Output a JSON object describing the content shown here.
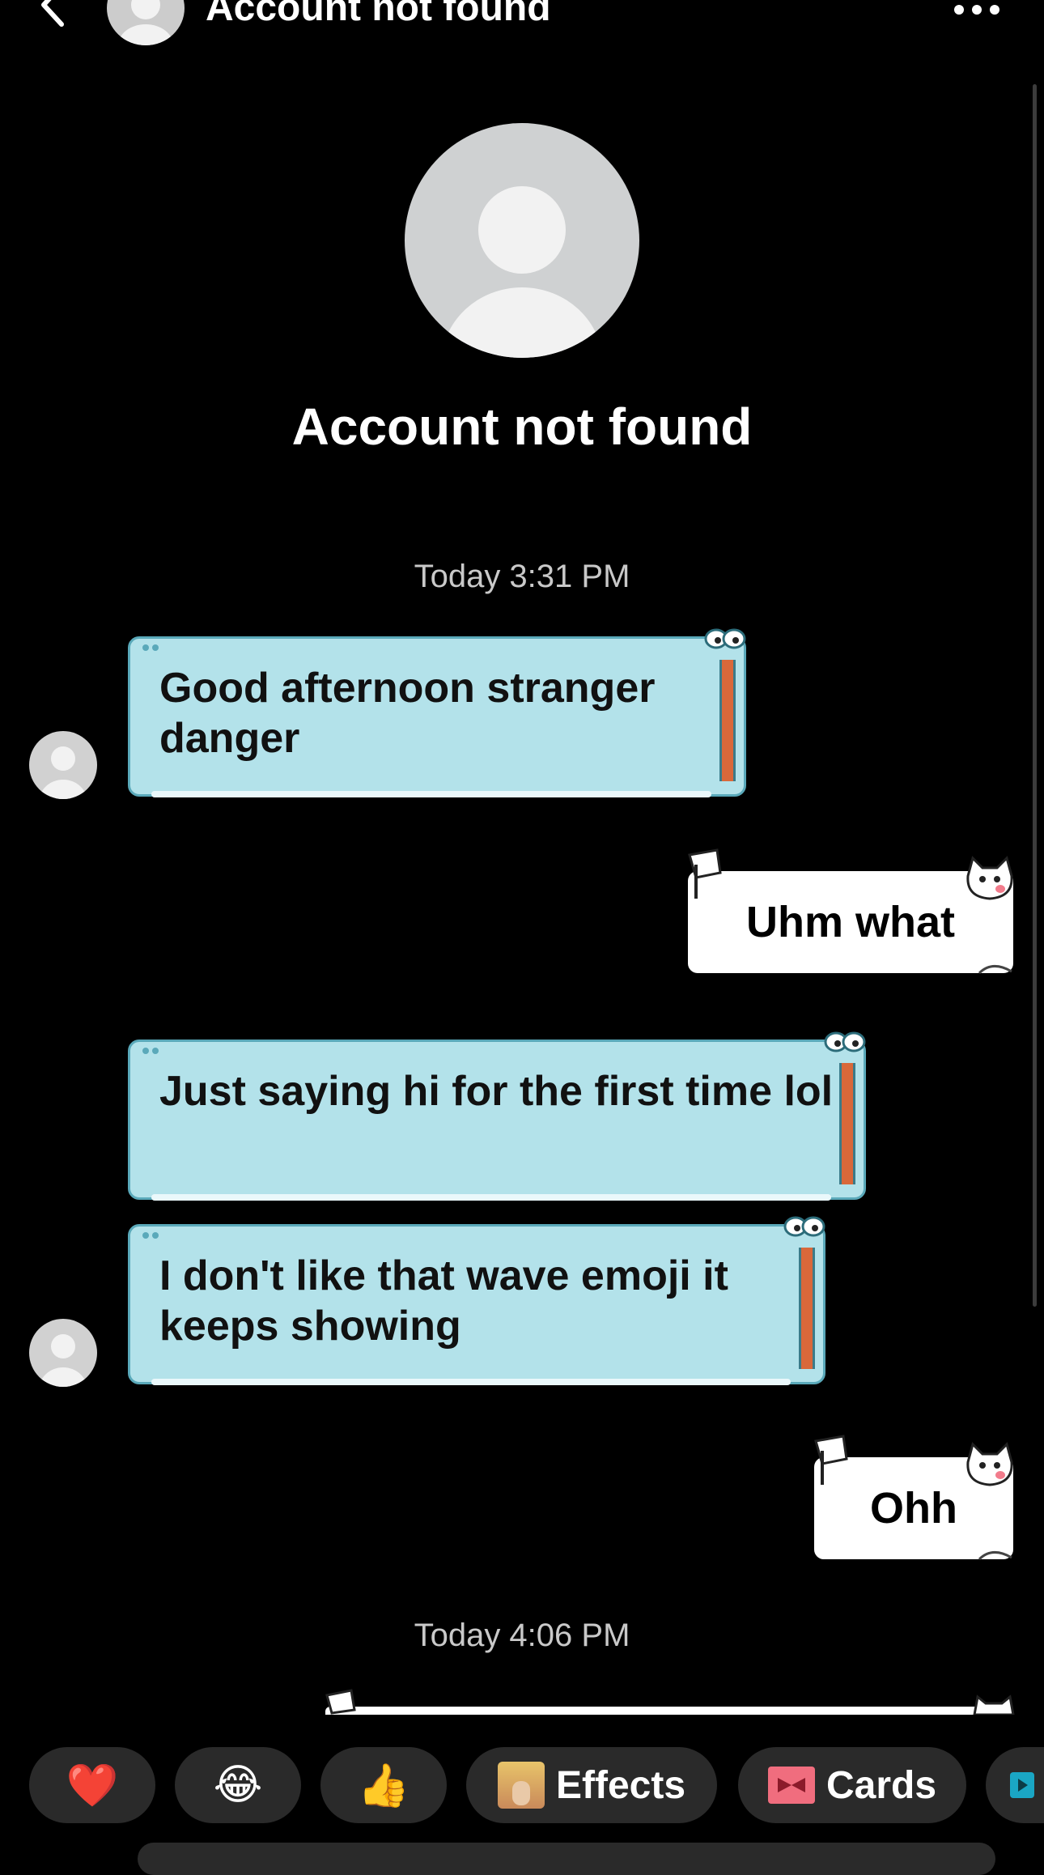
{
  "header": {
    "title": "Account not found"
  },
  "profile": {
    "name": "Account not found"
  },
  "timestamps": {
    "first": "Today 3:31 PM",
    "second": "Today 4:06 PM"
  },
  "messages": [
    {
      "direction": "received",
      "text": "Good afternoon stranger danger"
    },
    {
      "direction": "sent",
      "text": "Uhm what"
    },
    {
      "direction": "received",
      "text": "Just saying hi for the first time lol"
    },
    {
      "direction": "received",
      "text": "I don't like that wave emoji it keeps showing"
    },
    {
      "direction": "sent",
      "text": "Ohh"
    }
  ],
  "action_bar": {
    "reactions": [
      {
        "icon": "heart-icon",
        "glyph": "❤️"
      },
      {
        "icon": "laughing-crying-icon",
        "glyph": "😂"
      },
      {
        "icon": "thumbs-up-icon",
        "glyph": "👍"
      }
    ],
    "effects_label": "Effects",
    "cards_label": "Cards"
  },
  "colors": {
    "background": "#000000",
    "received_bubble": "#b3e2ea",
    "sent_bubble": "#ffffff",
    "chip_background": "#2a2a2a",
    "timestamp_text": "#c9c9c9"
  }
}
